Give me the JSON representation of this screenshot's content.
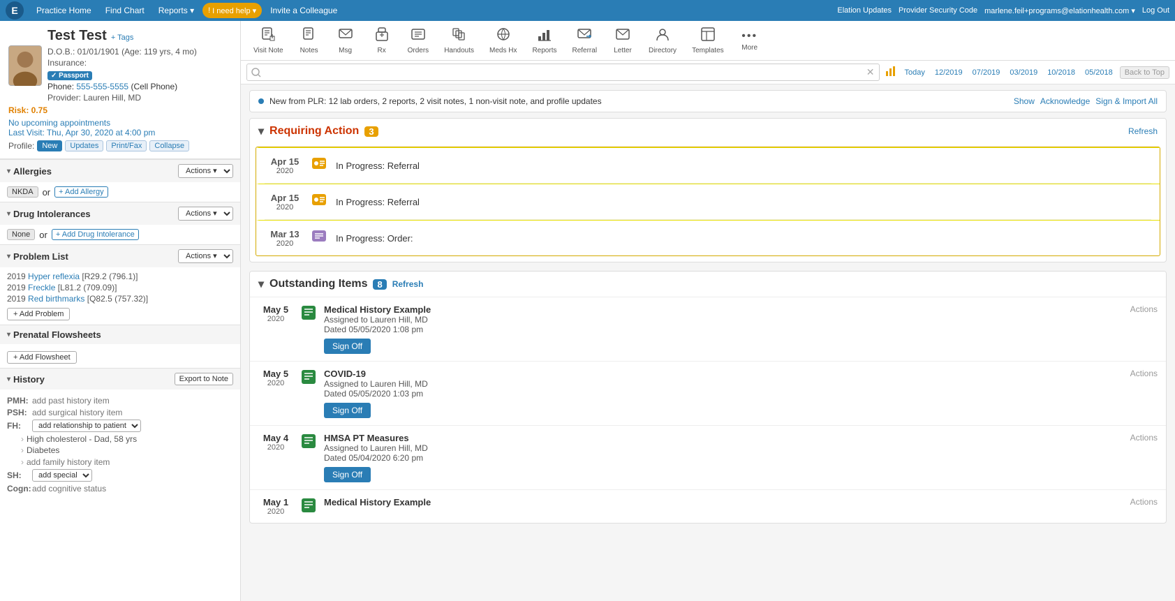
{
  "topNav": {
    "logo": "E",
    "links": [
      "Practice Home",
      "Find Chart",
      "Reports ▾",
      "I need help ▾",
      "Invite a Colleague"
    ],
    "alertLabel": "! I need help",
    "rightLinks": [
      "Elation Updates",
      "Provider Security Code",
      "marlene.feil+programs@elationhealth.com ▾",
      "Log Out"
    ]
  },
  "patient": {
    "name": "Test Test",
    "tagsLabel": "+ Tags",
    "dob": "D.O.B.: 01/01/1901 (Age: 119 yrs, 4 mo)",
    "insurance": "Insurance:",
    "passportBadge": "✓ Passport",
    "phone": "555-555-5555",
    "phoneType": "(Cell Phone)",
    "provider": "Provider: Lauren Hill, MD",
    "risk": "Risk: 0.75",
    "appointments": "No upcoming appointments",
    "lastVisit": "Last Visit: Thu, Apr 30, 2020 at 4:00 pm",
    "profileLabel": "Profile:",
    "profileButtons": [
      "New",
      "Updates",
      "Print/Fax",
      "Collapse"
    ]
  },
  "allergies": {
    "title": "Allergies",
    "actionsLabel": "Actions ▾",
    "nkdaLabel": "NKDA",
    "orLabel": "or",
    "addLabel": "+ Add Allergy"
  },
  "drugIntolerances": {
    "title": "Drug Intolerances",
    "actionsLabel": "Actions ▾",
    "noneLabel": "None",
    "orLabel": "or",
    "addLabel": "+ Add Drug Intolerance"
  },
  "problemList": {
    "title": "Problem List",
    "actionsLabel": "Actions ▾",
    "problems": [
      {
        "year": "2019",
        "name": "Hyper reflexia",
        "code": "R29.2",
        "extra": "(796.1)"
      },
      {
        "year": "2019",
        "name": "Freckle",
        "code": "L81.2",
        "extra": "(709.09)"
      },
      {
        "year": "2019",
        "name": "Red birthmarks",
        "code": "Q82.5",
        "extra": "(757.32)"
      }
    ],
    "addLabel": "+ Add Problem"
  },
  "prenatalFlowsheets": {
    "title": "Prenatal Flowsheets",
    "addLabel": "+ Add Flowsheet"
  },
  "history": {
    "title": "History",
    "exportLabel": "Export to Note",
    "pmhLabel": "PMH:",
    "pmhPlaceholder": "add past history item",
    "pshLabel": "PSH:",
    "pshPlaceholder": "add surgical history item",
    "fhLabel": "FH:",
    "fhDropdownDefault": "add relationship to patient",
    "fhItems": [
      {
        "label": "High cholesterol - Dad, 58 yrs"
      },
      {
        "label": "Diabetes"
      }
    ],
    "fhAddLabel": "add family history item",
    "shLabel": "SH:",
    "shDropdown": "add special",
    "cogLabel": "Cogn:",
    "cogPlaceholder": "add cognitive status"
  },
  "toolbar": {
    "buttons": [
      {
        "label": "Visit Note",
        "icon": "📋"
      },
      {
        "label": "Notes",
        "icon": "📝"
      },
      {
        "label": "Msg",
        "icon": "✉"
      },
      {
        "label": "Rx",
        "icon": "💊"
      },
      {
        "label": "Orders",
        "icon": "🗂"
      },
      {
        "label": "Handouts",
        "icon": "📚"
      },
      {
        "label": "Meds Hx",
        "icon": "💉"
      },
      {
        "label": "Reports",
        "icon": "📊"
      },
      {
        "label": "Referral",
        "icon": "📤"
      },
      {
        "label": "Letter",
        "icon": "✉"
      },
      {
        "label": "Directory",
        "icon": "🔍"
      },
      {
        "label": "Templates",
        "icon": "📄"
      },
      {
        "label": "More",
        "icon": "•••"
      }
    ]
  },
  "search": {
    "placeholder": "",
    "clearIcon": "✕",
    "timelineIcon": "📊",
    "timelineLabel": "Today",
    "timelineLinks": [
      "12/2019",
      "07/2019",
      "03/2019",
      "10/2018",
      "05/2018"
    ],
    "backToTop": "Back to Top"
  },
  "plrBanner": {
    "text": "New from PLR: 12 lab orders, 2 reports, 2 visit notes, 1 non-visit note, and profile updates",
    "showLabel": "Show",
    "acknowledgeLabel": "Acknowledge",
    "signImportLabel": "Sign & Import All"
  },
  "requiringAction": {
    "title": "Requiring Action",
    "count": "3",
    "refreshLabel": "Refresh",
    "items": [
      {
        "dateMonthDay": "Apr 15",
        "year": "2020",
        "text": "In Progress: Referral"
      },
      {
        "dateMonthDay": "Apr 15",
        "year": "2020",
        "text": "In Progress: Referral"
      },
      {
        "dateMonthDay": "Mar 13",
        "year": "2020",
        "text": "In Progress: Order:"
      }
    ]
  },
  "outstandingItems": {
    "title": "Outstanding Items",
    "count": "8",
    "refreshLabel": "Refresh",
    "items": [
      {
        "dateMonthDay": "May 5",
        "year": "2020",
        "title": "Medical History Example",
        "assigned": "Assigned to Lauren Hill, MD",
        "dated": "Dated 05/05/2020 1:08 pm",
        "actionsLabel": "Actions",
        "signOffLabel": "Sign Off"
      },
      {
        "dateMonthDay": "May 5",
        "year": "2020",
        "title": "COVID-19",
        "assigned": "Assigned to Lauren Hill, MD",
        "dated": "Dated 05/05/2020 1:03 pm",
        "actionsLabel": "Actions",
        "signOffLabel": "Sign Off"
      },
      {
        "dateMonthDay": "May 4",
        "year": "2020",
        "title": "HMSA PT Measures",
        "assigned": "Assigned to Lauren Hill, MD",
        "dated": "Dated 05/04/2020 6:20 pm",
        "actionsLabel": "Actions",
        "signOffLabel": "Sign Off"
      },
      {
        "dateMonthDay": "May 1",
        "year": "2020",
        "title": "Medical History Example",
        "assigned": "",
        "dated": "",
        "actionsLabel": "Actions",
        "signOffLabel": ""
      }
    ]
  }
}
